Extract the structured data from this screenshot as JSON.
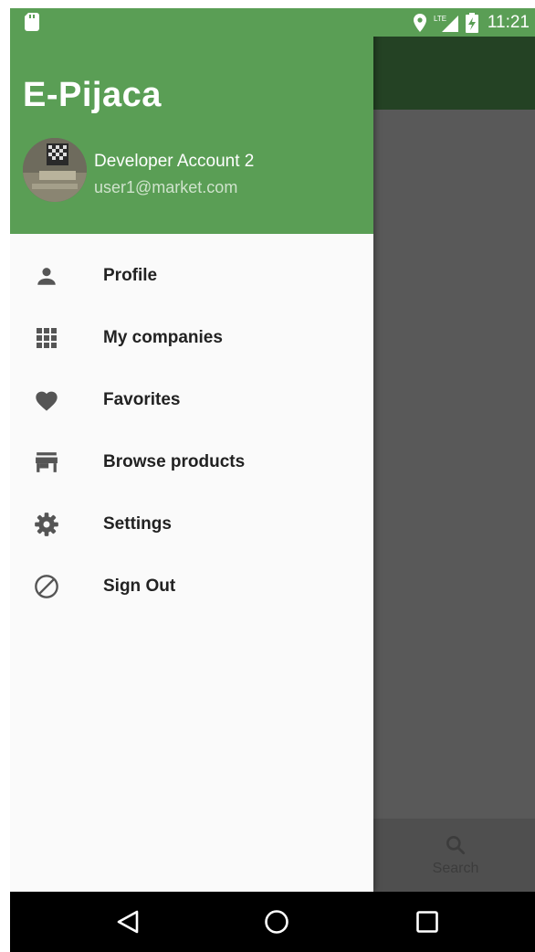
{
  "status_bar": {
    "time": "11:21",
    "network": "LTE"
  },
  "drawer": {
    "title": "E-Pijaca",
    "user": {
      "name": "Developer Account 2",
      "email": "user1@market.com"
    },
    "items": [
      {
        "label": "Profile",
        "icon": "person-icon"
      },
      {
        "label": "My companies",
        "icon": "grid-icon"
      },
      {
        "label": "Favorites",
        "icon": "heart-icon"
      },
      {
        "label": "Browse products",
        "icon": "store-icon"
      },
      {
        "label": "Settings",
        "icon": "gear-icon"
      },
      {
        "label": "Sign Out",
        "icon": "block-icon"
      }
    ]
  },
  "bottom_nav": {
    "search_label": "Search"
  },
  "colors": {
    "primary": "#5a9e55",
    "toolbar_dark": "#244224",
    "scrim": "#595959"
  }
}
